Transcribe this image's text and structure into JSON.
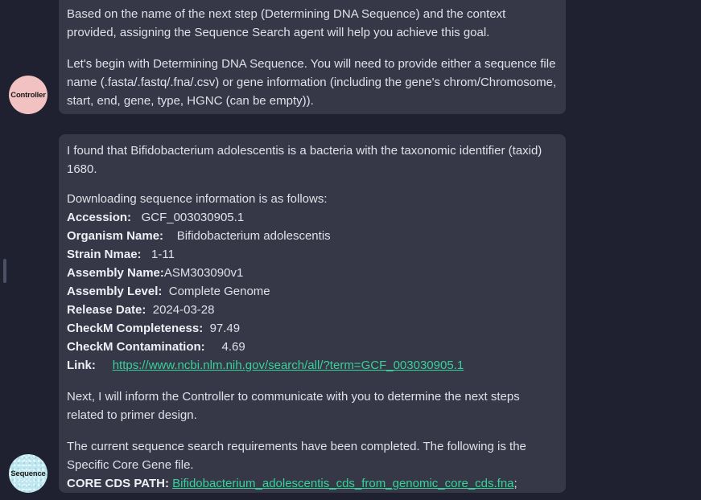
{
  "messages": {
    "controller": {
      "avatar_label": "Controller",
      "para1": "Based on the name of the next step (Determining DNA Sequence) and the context provided, assigning the Sequence Search agent will help you achieve this goal.",
      "para2": "Let's begin with Determining DNA Sequence. You will need to provide either a sequence file name (.fasta/.fastq/.fna/.csv) or gene information (including the gene's chrom/Chromosome, start, end, gene, type, HGNC (can be empty))."
    },
    "sequence": {
      "avatar_label": "Sequence",
      "intro": "I found that Bifidobacterium adolescentis is a bacteria with the taxonomic identifier (taxid) 1680.",
      "download_heading": "Downloading sequence information is as follows:",
      "fields": {
        "accession_label": "Accession:",
        "accession_value": "GCF_003030905.1",
        "organism_label": "Organism Name:",
        "organism_value": "Bifidobacterium adolescentis",
        "strain_label": "Strain Nmae:",
        "strain_value": "1-11",
        "assembly_name_label": "Assembly Name:",
        "assembly_name_value": "ASM303090v1",
        "assembly_level_label": "Assembly Level:",
        "assembly_level_value": "Complete Genome",
        "release_label": "Release Date:",
        "release_value": "2024-03-28",
        "completeness_label": "CheckM Completeness:",
        "completeness_value": "97.49",
        "contamination_label": "CheckM Contamination:",
        "contamination_value": "4.69",
        "link_label": "Link:",
        "link_value": "https://www.ncbi.nlm.nih.gov/search/all/?term=GCF_003030905.1"
      },
      "next_step": "Next,  I will inform the Controller to communicate with you to determine the next steps related to primer design.",
      "completion": "The current sequence search requirements have been completed. The following is the Specific Core Gene file.",
      "core_path_label": "CORE CDS PATH:",
      "core_path_value": "Bifidobacterium_adolescentis_cds_from_genomic_core_cds.fna",
      "core_path_suffix": ";"
    }
  }
}
